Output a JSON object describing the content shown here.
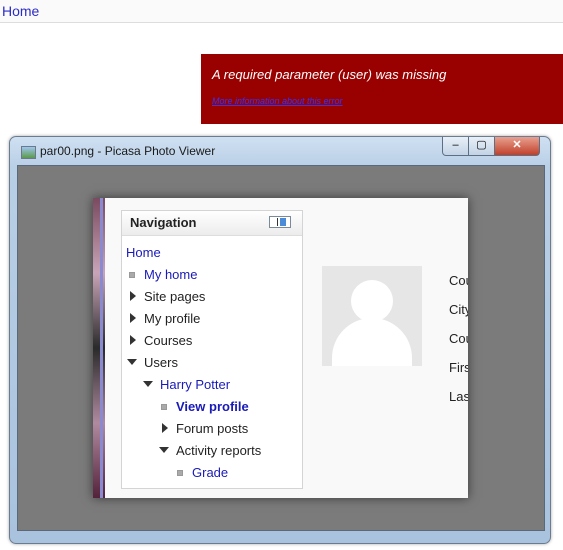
{
  "topbar": {
    "home_label": "Home"
  },
  "error": {
    "message": "A required parameter (user) was missing",
    "more_info": "More information about this error"
  },
  "viewer": {
    "title": "par00.png - Picasa Photo Viewer",
    "controls": {
      "minimize": "–",
      "maximize": "▢",
      "close": "✕"
    }
  },
  "navigation": {
    "title": "Navigation",
    "items": [
      {
        "label": "Home"
      },
      {
        "label": "My home"
      },
      {
        "label": "Site pages"
      },
      {
        "label": "My profile"
      },
      {
        "label": "Courses"
      },
      {
        "label": "Users"
      },
      {
        "label": "Harry Potter"
      },
      {
        "label": "View profile"
      },
      {
        "label": "Forum posts"
      },
      {
        "label": "Activity reports"
      },
      {
        "label": "Grade"
      }
    ]
  },
  "profile_fields": [
    "Cou",
    "City",
    "Cou",
    "Firs",
    "Las"
  ],
  "colors": {
    "error_bg": "#990000",
    "link": "#1a1ab8",
    "viewer_bg": "#7b7b7b"
  }
}
